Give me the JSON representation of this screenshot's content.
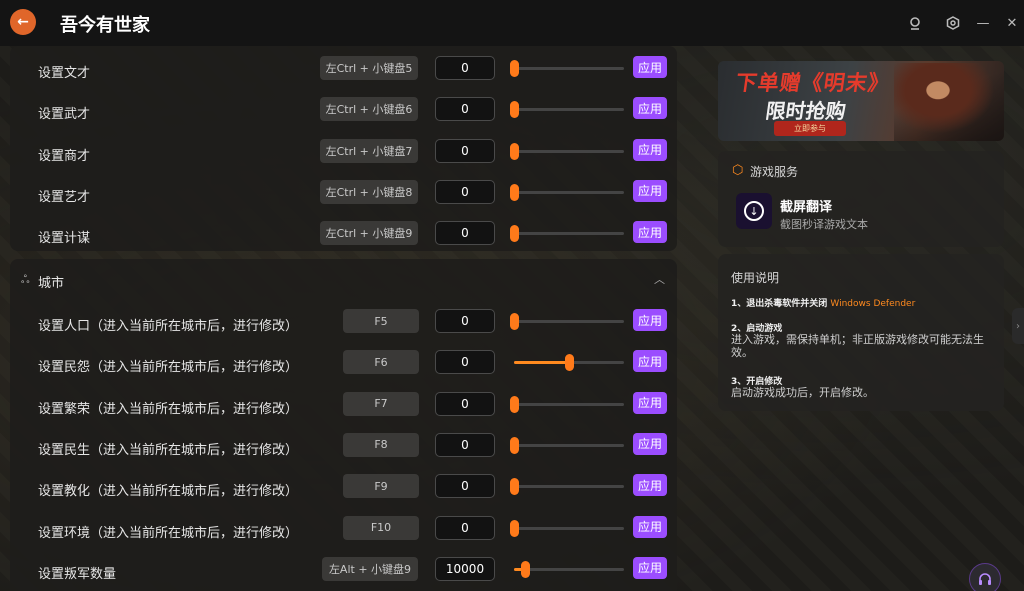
{
  "app": {
    "title": "吾今有世家"
  },
  "titlebar_icons": {
    "back": "arrow-left-icon",
    "user": "user-icon",
    "settings": "gear-icon",
    "minimize": "minimize-icon",
    "close": "close-icon"
  },
  "person_section": {
    "rows": [
      {
        "label": "设置文才",
        "hotkey": "左Ctrl + 小键盘5",
        "value": "0",
        "slider": 0,
        "apply": "应用"
      },
      {
        "label": "设置武才",
        "hotkey": "左Ctrl + 小键盘6",
        "value": "0",
        "slider": 0,
        "apply": "应用"
      },
      {
        "label": "设置商才",
        "hotkey": "左Ctrl + 小键盘7",
        "value": "0",
        "slider": 0,
        "apply": "应用"
      },
      {
        "label": "设置艺才",
        "hotkey": "左Ctrl + 小键盘8",
        "value": "0",
        "slider": 0,
        "apply": "应用"
      },
      {
        "label": "设置计谋",
        "hotkey": "左Ctrl + 小键盘9",
        "value": "0",
        "slider": 0,
        "apply": "应用"
      }
    ]
  },
  "city_section": {
    "title": "城市",
    "rows": [
      {
        "label": "设置人口（进入当前所在城市后，进行修改）",
        "hotkey": "F5",
        "value": "0",
        "slider": 0,
        "apply": "应用"
      },
      {
        "label": "设置民怨（进入当前所在城市后，进行修改）",
        "hotkey": "F6",
        "value": "0",
        "slider": 0.5,
        "apply": "应用"
      },
      {
        "label": "设置繁荣（进入当前所在城市后，进行修改）",
        "hotkey": "F7",
        "value": "0",
        "slider": 0,
        "apply": "应用"
      },
      {
        "label": "设置民生（进入当前所在城市后，进行修改）",
        "hotkey": "F8",
        "value": "0",
        "slider": 0,
        "apply": "应用"
      },
      {
        "label": "设置教化（进入当前所在城市后，进行修改）",
        "hotkey": "F9",
        "value": "0",
        "slider": 0,
        "apply": "应用"
      },
      {
        "label": "设置环境（进入当前所在城市后，进行修改）",
        "hotkey": "F10",
        "value": "0",
        "slider": 0,
        "apply": "应用"
      },
      {
        "label": "设置叛军数量",
        "hotkey": "左Alt + 小键盘9",
        "value": "10000",
        "slider": 0.1,
        "apply": "应用"
      }
    ]
  },
  "banner": {
    "title": "下单赠《明末》",
    "subtitle": "限时抢购",
    "cta": "立即参与"
  },
  "game_service": {
    "header": "游戏服务",
    "tool_name": "截屏翻译",
    "tool_desc": "截图秒译游戏文本"
  },
  "usage": {
    "title": "使用说明",
    "step1_head": "1、退出杀毒软件并关闭",
    "step1_highlight": "Windows Defender",
    "step2_head": "2、启动游戏",
    "step2_body": "进入游戏，需保持单机；非正版游戏修改可能无法生效。",
    "step3_head": "3、开启修改",
    "step3_body": "启动游戏成功后，开启修改。"
  },
  "colors": {
    "accent_orange": "#ff8a1f",
    "apply_purple": "#9b4dff",
    "banner_red": "#e53b2c"
  }
}
